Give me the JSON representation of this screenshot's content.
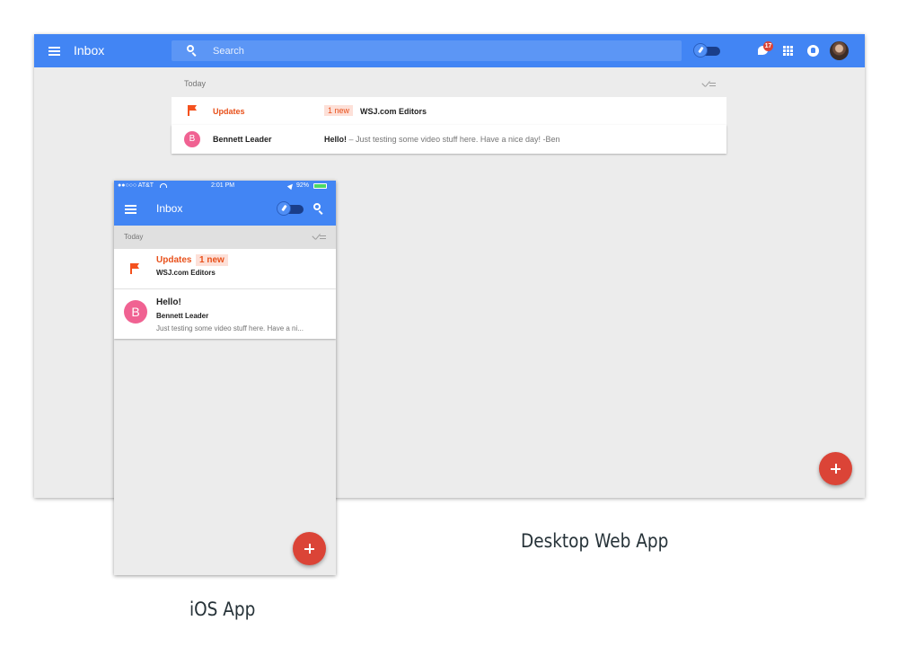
{
  "desktop": {
    "app_title": "Inbox",
    "search_placeholder": "Search",
    "notification_count": "17",
    "section_label": "Today",
    "rows": [
      {
        "sender": "Updates",
        "badge": "1 new",
        "subject": "WSJ.com Editors",
        "snippet": ""
      },
      {
        "avatar_letter": "B",
        "sender": "Bennett Leader",
        "subject": "Hello!",
        "snippet": " – Just testing some video stuff here. Have a nice day! -Ben"
      }
    ],
    "caption": "Desktop Web App"
  },
  "ios": {
    "status": {
      "carrier": "●●○○○ AT&T",
      "time": "2:01 PM",
      "battery": "92%"
    },
    "app_title": "Inbox",
    "section_label": "Today",
    "rows": [
      {
        "title": "Updates",
        "badge": "1 new",
        "sender": "WSJ.com Editors"
      },
      {
        "avatar_letter": "B",
        "title": "Hello!",
        "sender": "Bennett Leader",
        "snippet": "Just testing some video stuff here. Have a ni..."
      }
    ],
    "caption": "iOS App"
  },
  "colors": {
    "primary": "#4285f4",
    "accent": "#db4437",
    "flag": "#f4511e",
    "avatar": "#f06292",
    "background": "#ececec"
  },
  "icons": [
    "menu-icon",
    "search-icon",
    "pin-toggle-icon",
    "notification-bubble-icon",
    "apps-grid-icon",
    "reminder-icon",
    "flag-icon",
    "sweep-checks-icon",
    "plus-icon",
    "wifi-icon",
    "location-icon",
    "battery-icon"
  ]
}
